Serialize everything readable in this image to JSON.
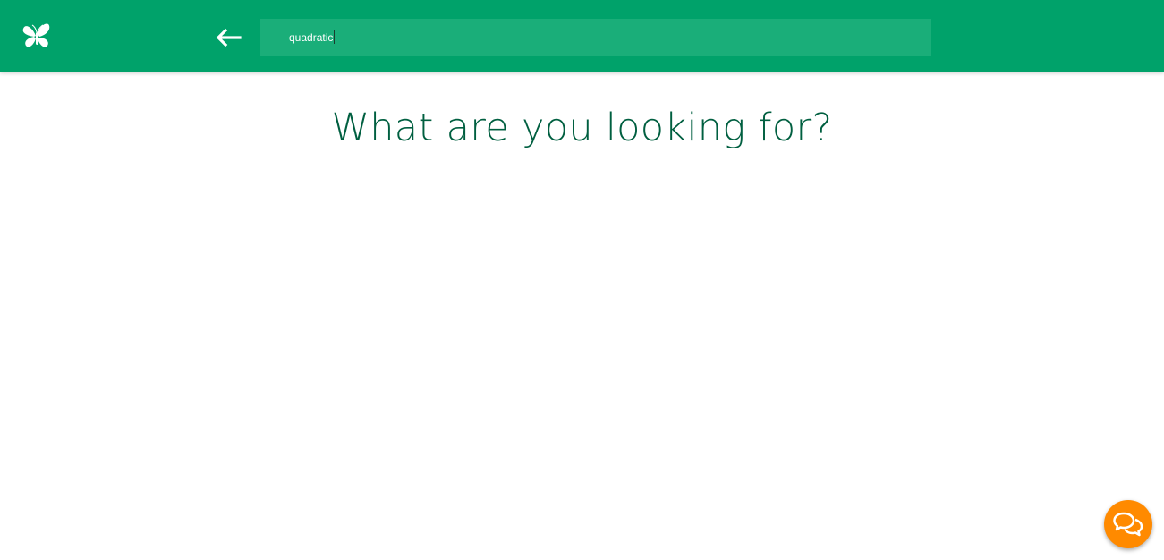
{
  "header": {
    "logo_icon": "butterfly-icon",
    "back_icon": "arrow-left-icon",
    "background_color": "#00a26a",
    "search": {
      "value": "quadratic",
      "placeholder": ""
    }
  },
  "main": {
    "title": "What are you looking for?",
    "title_color": "#005f40"
  },
  "chat": {
    "icon": "chat-bubbles-icon",
    "color": "#ff8a00"
  }
}
